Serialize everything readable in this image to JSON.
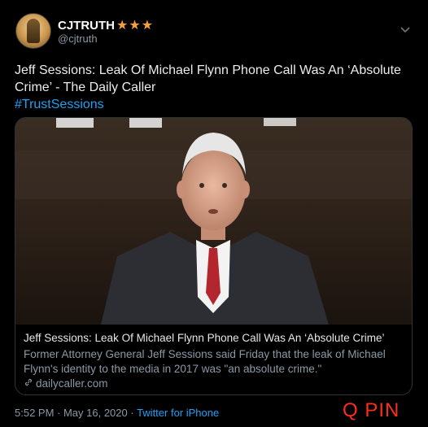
{
  "author": {
    "name": "CJTRUTH",
    "stars": "★★★",
    "handle": "@cjtruth"
  },
  "tweet": {
    "text": "Jeff Sessions: Leak Of Michael Flynn Phone Call Was An ‘Absolute Crime’ - The Daily Caller",
    "hashtag": "#TrustSessions"
  },
  "card": {
    "title": "Jeff Sessions: Leak Of Michael Flynn Phone Call Was An ‘Absolute Crime’",
    "description": "Former Attorney General Jeff Sessions said Friday that the leak of Michael Flynn's identity to the media in 2017 was \"an absolute crime.\"",
    "domain": "dailycaller.com"
  },
  "footer": {
    "time": "5:52 PM · May 16, 2020 · ",
    "source": "Twitter for iPhone"
  },
  "watermark": "Q PIN",
  "colors": {
    "link": "#1da1f2",
    "stars": "#f4a13c",
    "watermark": "#ff2b1c"
  },
  "icons": [
    "chevron-down-icon",
    "link-icon"
  ]
}
